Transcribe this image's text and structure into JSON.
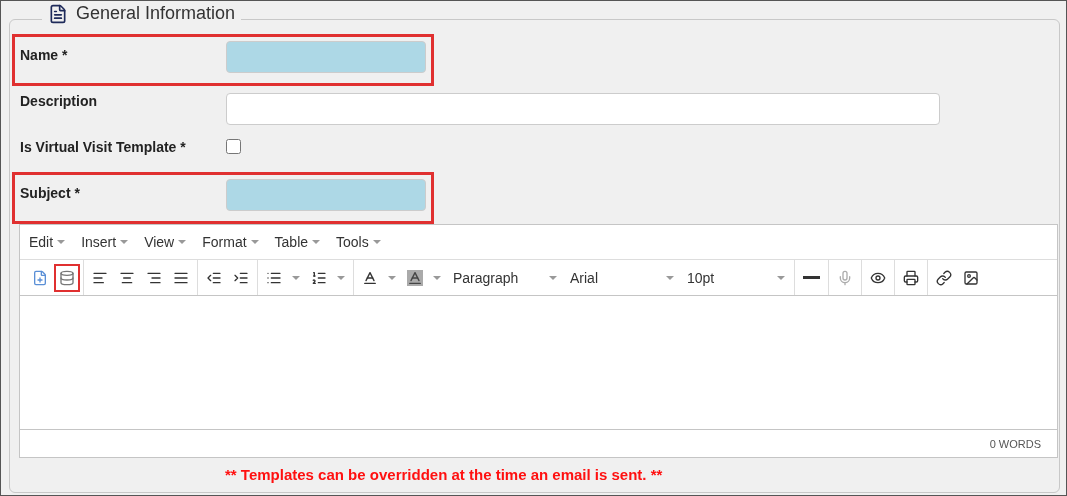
{
  "section": {
    "legend": "General Information"
  },
  "fields": [
    {
      "kind": "required-text",
      "label": "Name *",
      "highlighted": true
    },
    {
      "kind": "text",
      "label": "Description",
      "highlighted": false
    },
    {
      "kind": "checkbox",
      "label": "Is Virtual Visit Template *",
      "highlighted": false,
      "checked": false
    },
    {
      "kind": "required-text",
      "label": "Subject *",
      "highlighted": true
    }
  ],
  "editor": {
    "menus": [
      "Edit",
      "Insert",
      "View",
      "Format",
      "Table",
      "Tools"
    ],
    "toolbar": [
      {
        "kind": "button",
        "highlighted": false,
        "disabled": false
      },
      {
        "kind": "button",
        "highlighted": true,
        "disabled": false
      },
      {
        "kind": "button",
        "highlighted": false,
        "disabled": false
      },
      {
        "kind": "button",
        "highlighted": false,
        "disabled": false
      },
      {
        "kind": "button",
        "highlighted": false,
        "disabled": false
      },
      {
        "kind": "button",
        "highlighted": false,
        "disabled": false
      },
      {
        "kind": "button",
        "highlighted": false,
        "disabled": false
      },
      {
        "kind": "button",
        "highlighted": false,
        "disabled": false
      },
      {
        "kind": "split",
        "highlighted": false,
        "disabled": false
      },
      {
        "kind": "split",
        "highlighted": false,
        "disabled": false
      },
      {
        "kind": "split",
        "highlighted": false,
        "disabled": false
      },
      {
        "kind": "split",
        "highlighted": false,
        "disabled": false
      },
      {
        "kind": "select",
        "value": "Paragraph"
      },
      {
        "kind": "select",
        "value": "Arial"
      },
      {
        "kind": "select",
        "value": "10pt"
      },
      {
        "kind": "button",
        "highlighted": false,
        "disabled": false
      },
      {
        "kind": "button",
        "highlighted": false,
        "disabled": true
      },
      {
        "kind": "button",
        "highlighted": false,
        "disabled": false
      },
      {
        "kind": "button",
        "highlighted": false,
        "disabled": false
      },
      {
        "kind": "button",
        "highlighted": false,
        "disabled": false
      },
      {
        "kind": "button",
        "highlighted": false,
        "disabled": false
      }
    ],
    "word_count": "0 WORDS"
  },
  "note": "** Templates can be overridden at the time an email is sent. **"
}
